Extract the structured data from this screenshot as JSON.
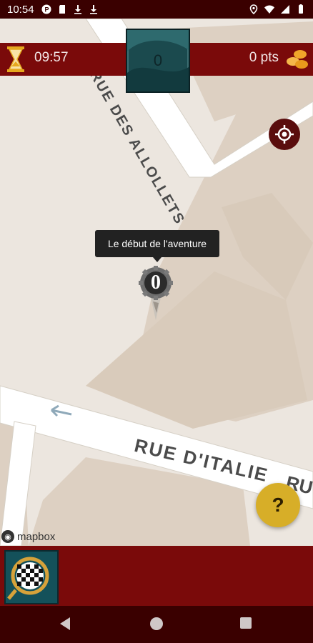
{
  "status_bar": {
    "time": "10:54",
    "icons": [
      "p-icon",
      "sd-card-icon",
      "download-icon",
      "download-icon",
      "location-icon",
      "wifi-icon",
      "signal-icon",
      "battery-icon"
    ]
  },
  "header": {
    "timer": "09:57",
    "points": "0 pts",
    "score": "0"
  },
  "map": {
    "tooltip": "Le début de l'aventure",
    "marker_number": "0",
    "street_top": "RUE DES ALLOLLETS",
    "street_main": "RUE D'ITALIE",
    "street_main_partial": "RU",
    "attribution": "mapbox"
  },
  "help_button": "?",
  "colors": {
    "bar": "#7a0a0a",
    "status": "#3a0000",
    "help": "#d7ae28",
    "map_bg": "#ece6df"
  }
}
